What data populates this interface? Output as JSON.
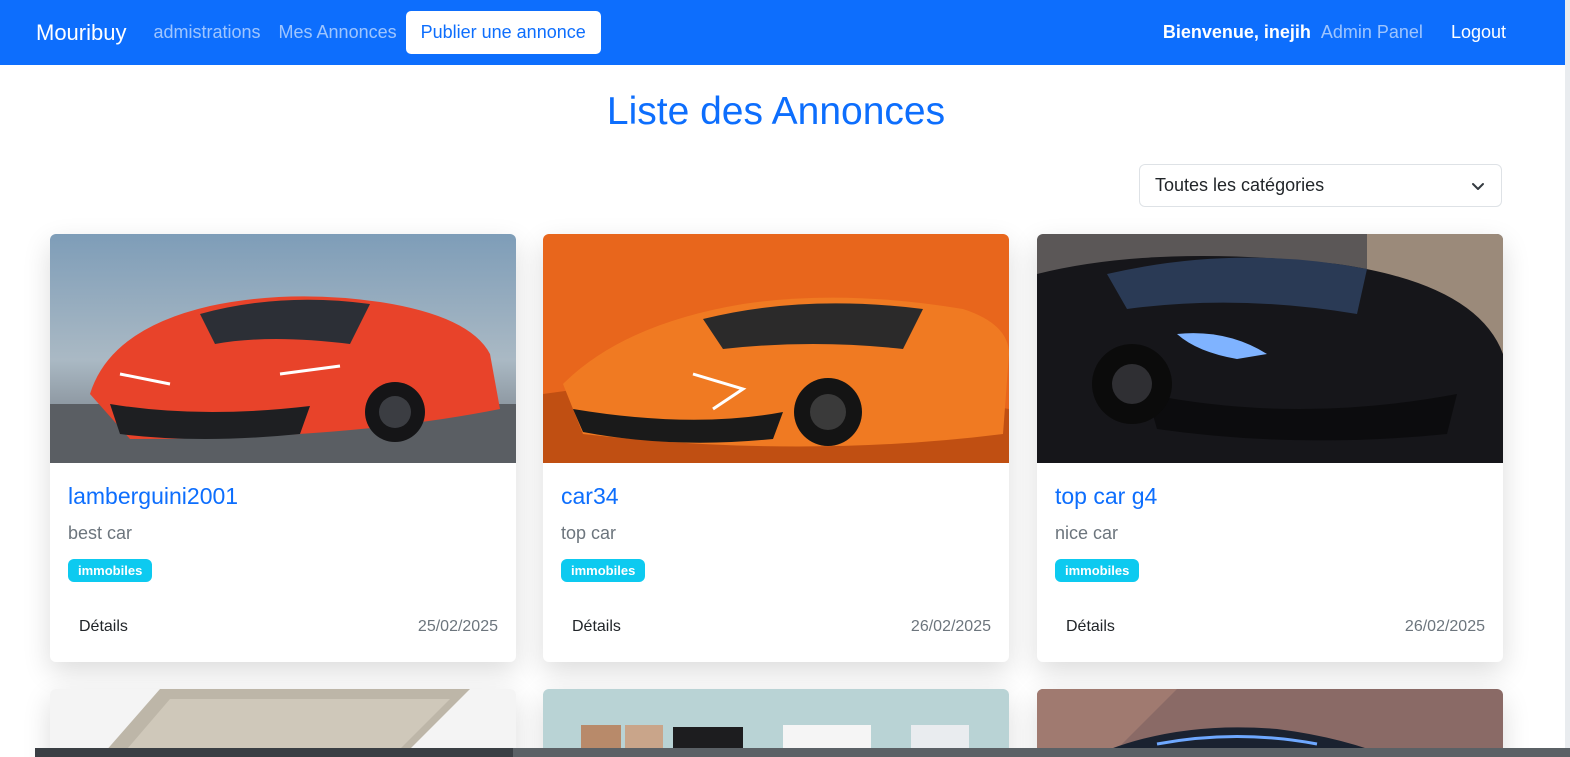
{
  "navbar": {
    "brand": "Mouribuy",
    "links": [
      "admistrations",
      "Mes Annonces"
    ],
    "publish_label": "Publier une annonce",
    "welcome": "Bienvenue, inejih",
    "admin_label": "Admin Panel",
    "logout_label": "Logout"
  },
  "main": {
    "title": "Liste des Annonces",
    "filter": {
      "selected": "Toutes les catégories"
    },
    "cards": [
      {
        "title": "lamberguini2001",
        "description": "best car",
        "badge": "immobiles",
        "details_label": "Détails",
        "date": "25/02/2025",
        "image": "red-sports-car"
      },
      {
        "title": "car34",
        "description": "top car",
        "badge": "immobiles",
        "details_label": "Détails",
        "date": "26/02/2025",
        "image": "orange-sports-car"
      },
      {
        "title": "top car g4",
        "description": "nice car",
        "badge": "immobiles",
        "details_label": "Détails",
        "date": "26/02/2025",
        "image": "black-sports-car"
      }
    ],
    "next_row_images": [
      "laptop",
      "appliances",
      "sports-car"
    ]
  },
  "colors": {
    "primary": "#0d6efd",
    "badge": "#0dcaf0",
    "muted": "#6c757d"
  }
}
